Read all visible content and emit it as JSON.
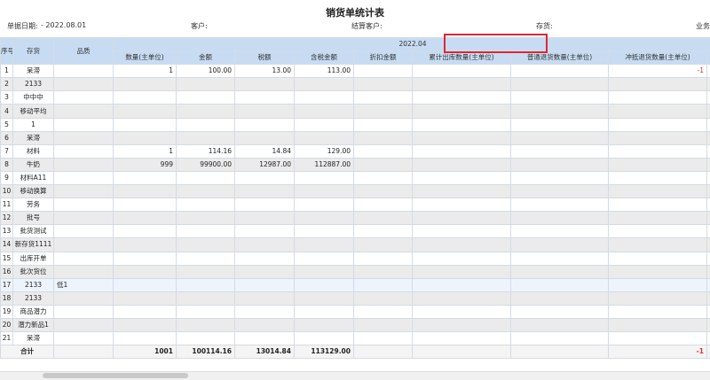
{
  "title": "销货单统计表",
  "filters": {
    "date_label": "单据日期:",
    "date_value": "- 2022.08.01",
    "customer_label": "客户:",
    "settle_customer_label": "结算客户:",
    "stock_label": "存货:",
    "business_label": "业务"
  },
  "headers": {
    "rownum": "序号",
    "stock": "存货",
    "quality": "品质",
    "period": "2022.04",
    "qty": "数量(主单位)",
    "amount": "金额",
    "tax": "税额",
    "tax_amount": "含税金额",
    "discount": "折扣金额",
    "cumulative_out": "累计出库数量(主单位)",
    "normal_return": "普通退货数量(主单位)",
    "offset_return": "冲抵退货数量(主单位)"
  },
  "rows": [
    {
      "no": "1",
      "stock": "呆滞",
      "quality": "",
      "qty": "1",
      "amount": "100.00",
      "tax": "13.00",
      "tax_amount": "113.00",
      "offset": "-1"
    },
    {
      "no": "2",
      "stock": "2133",
      "quality": "",
      "qty": "",
      "amount": "",
      "tax": "",
      "tax_amount": "",
      "offset": ""
    },
    {
      "no": "3",
      "stock": "中中中",
      "quality": "",
      "qty": "",
      "amount": "",
      "tax": "",
      "tax_amount": "",
      "offset": ""
    },
    {
      "no": "4",
      "stock": "移动平均",
      "quality": "",
      "qty": "",
      "amount": "",
      "tax": "",
      "tax_amount": "",
      "offset": ""
    },
    {
      "no": "5",
      "stock": "1",
      "quality": "",
      "qty": "",
      "amount": "",
      "tax": "",
      "tax_amount": "",
      "offset": ""
    },
    {
      "no": "6",
      "stock": "呆滞",
      "quality": "",
      "qty": "",
      "amount": "",
      "tax": "",
      "tax_amount": "",
      "offset": ""
    },
    {
      "no": "7",
      "stock": "材料",
      "quality": "",
      "qty": "1",
      "amount": "114.16",
      "tax": "14.84",
      "tax_amount": "129.00",
      "offset": ""
    },
    {
      "no": "8",
      "stock": "牛奶",
      "quality": "",
      "qty": "999",
      "amount": "99900.00",
      "tax": "12987.00",
      "tax_amount": "112887.00",
      "offset": ""
    },
    {
      "no": "9",
      "stock": "材料A11",
      "quality": "",
      "qty": "",
      "amount": "",
      "tax": "",
      "tax_amount": "",
      "offset": ""
    },
    {
      "no": "10",
      "stock": "移动换算",
      "quality": "",
      "qty": "",
      "amount": "",
      "tax": "",
      "tax_amount": "",
      "offset": ""
    },
    {
      "no": "11",
      "stock": "劳务",
      "quality": "",
      "qty": "",
      "amount": "",
      "tax": "",
      "tax_amount": "",
      "offset": ""
    },
    {
      "no": "12",
      "stock": "批号",
      "quality": "",
      "qty": "",
      "amount": "",
      "tax": "",
      "tax_amount": "",
      "offset": ""
    },
    {
      "no": "13",
      "stock": "批货测试",
      "quality": "",
      "qty": "",
      "amount": "",
      "tax": "",
      "tax_amount": "",
      "offset": ""
    },
    {
      "no": "14",
      "stock": "新存货1111",
      "quality": "",
      "qty": "",
      "amount": "",
      "tax": "",
      "tax_amount": "",
      "offset": ""
    },
    {
      "no": "15",
      "stock": "出库开单",
      "quality": "",
      "qty": "",
      "amount": "",
      "tax": "",
      "tax_amount": "",
      "offset": ""
    },
    {
      "no": "16",
      "stock": "批次货位",
      "quality": "",
      "qty": "",
      "amount": "",
      "tax": "",
      "tax_amount": "",
      "offset": ""
    },
    {
      "no": "17",
      "stock": "2133",
      "quality": "低1",
      "qty": "",
      "amount": "",
      "tax": "",
      "tax_amount": "",
      "offset": ""
    },
    {
      "no": "18",
      "stock": "2133",
      "quality": "",
      "qty": "",
      "amount": "",
      "tax": "",
      "tax_amount": "",
      "offset": ""
    },
    {
      "no": "19",
      "stock": "商品潜力",
      "quality": "",
      "qty": "",
      "amount": "",
      "tax": "",
      "tax_amount": "",
      "offset": ""
    },
    {
      "no": "20",
      "stock": "潜力新品1",
      "quality": "",
      "qty": "",
      "amount": "",
      "tax": "",
      "tax_amount": "",
      "offset": ""
    },
    {
      "no": "21",
      "stock": "呆滞",
      "quality": "",
      "qty": "",
      "amount": "",
      "tax": "",
      "tax_amount": "",
      "offset": ""
    }
  ],
  "total": {
    "label": "合计",
    "qty": "1001",
    "amount": "100114.16",
    "tax": "13014.84",
    "tax_amount": "113129.00",
    "offset": "-1"
  },
  "colors": {
    "header_bg": "#c7dcf3",
    "highlight": "#e0262f",
    "negative": "#e03030"
  }
}
